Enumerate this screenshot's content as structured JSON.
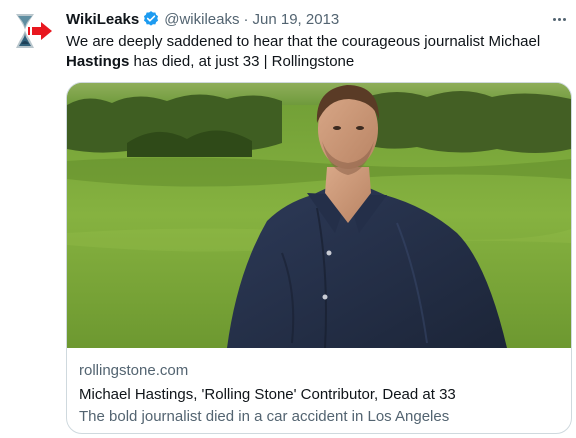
{
  "tweet": {
    "author": {
      "name": "WikiLeaks",
      "handle": "@wikileaks",
      "separator": "·",
      "date": "Jun 19, 2013",
      "avatar_icon": "wikileaks-hourglass-logo",
      "verified_icon": "verified-badge-icon"
    },
    "text": {
      "part1": "We are deeply saddened to hear that the courageous journalist Michael ",
      "bold": "Hastings",
      "part2": " has died, at just 33 | Rollingstone"
    },
    "more_icon": "more-options-icon",
    "card": {
      "image_alt": "Portrait of Michael Hastings in a green field",
      "domain": "rollingstone.com",
      "title": "Michael Hastings, 'Rolling Stone' Contributor, Dead at 33",
      "description": "The bold journalist died in a car accident in Los Angeles"
    }
  },
  "colors": {
    "text_primary": "#0f1419",
    "text_secondary": "#536471",
    "verified_blue": "#1d9bf0",
    "card_border": "#cfd9de",
    "avatar_arrow_red": "#e8171f"
  }
}
